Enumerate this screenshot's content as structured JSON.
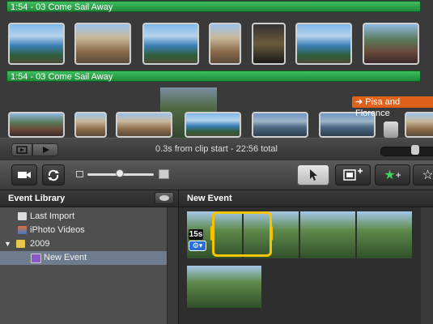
{
  "project": {
    "music_track_1": "1:54 - 03 Come Sail Away",
    "music_track_2": "1:54 - 03 Come Sail Away",
    "title_tag": "Pisa and Florence"
  },
  "status": {
    "text": "0.3s from clip start - 22:56 total"
  },
  "toolbar": {
    "camera_icon": "camera-icon",
    "swap_icon": "swap-arrows-icon",
    "arrow_icon": "arrow-pointer-icon",
    "add_to_project_icon": "add-to-project-icon",
    "favorite_icon": "star-plus-icon",
    "unfavorite_icon": "star-outline-icon",
    "star_glyph": "★",
    "star_outline_glyph": "☆",
    "plus": "+"
  },
  "library": {
    "title": "Event Library",
    "items": [
      {
        "label": "Last Import"
      },
      {
        "label": "iPhoto Videos"
      },
      {
        "label": "2009"
      },
      {
        "label": "New Event"
      }
    ]
  },
  "browser": {
    "title": "New Event",
    "clip_duration": "15s"
  },
  "colors": {
    "music_green": "#2fa84a",
    "title_orange": "#e0621a",
    "selection_yellow": "#f5c400",
    "library_selection": "#6f7b8f"
  }
}
